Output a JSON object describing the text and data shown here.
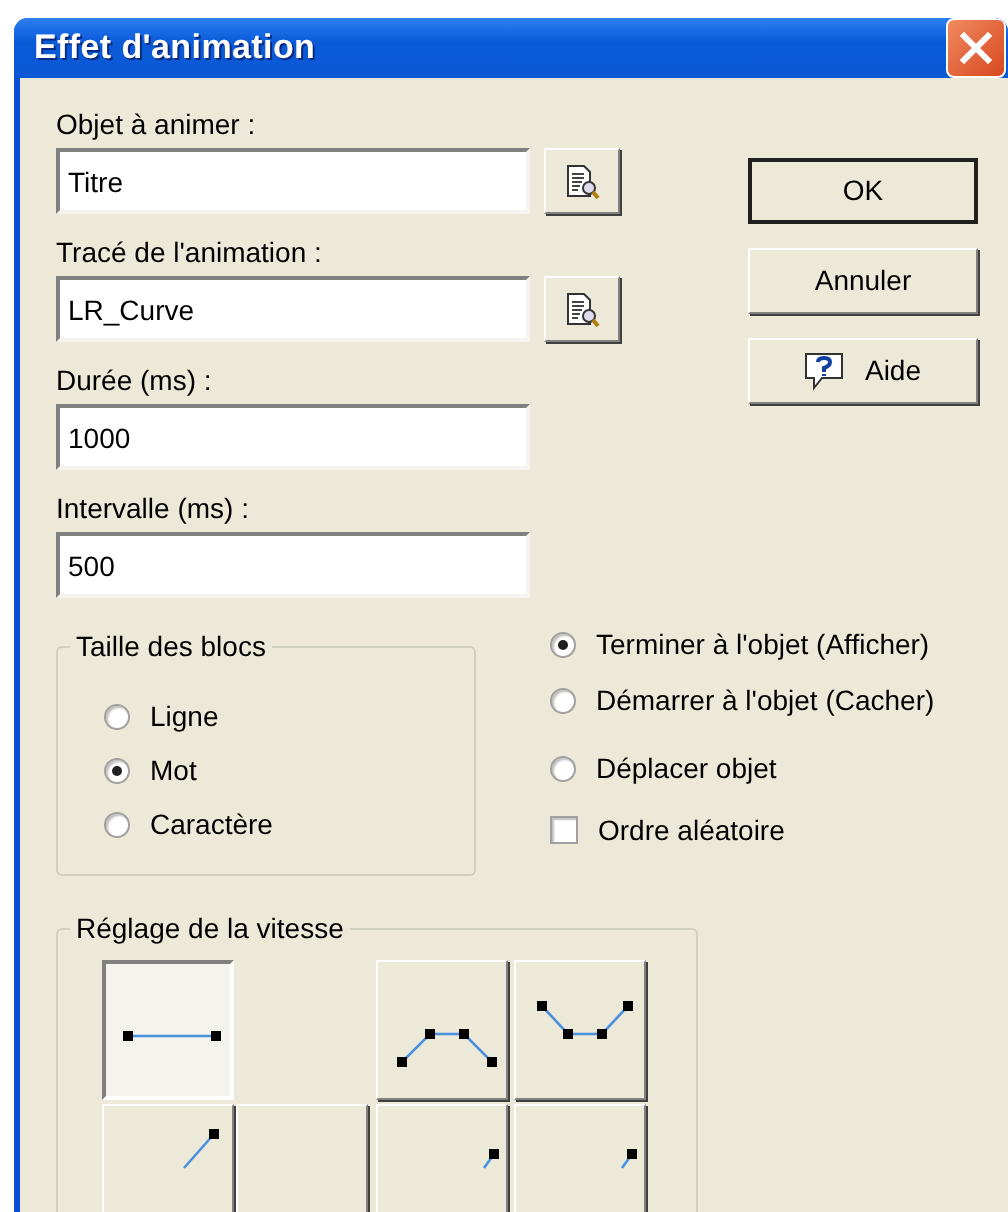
{
  "window": {
    "title": "Effet d'animation"
  },
  "fields": [
    {
      "label": "Objet à animer :",
      "value": "Titre",
      "browse": true
    },
    {
      "label": "Tracé de l'animation :",
      "value": "LR_Curve",
      "browse": true
    },
    {
      "label": "Durée (ms) :",
      "value": "1000",
      "browse": false
    },
    {
      "label": "Intervalle (ms) :",
      "value": "500",
      "browse": false
    }
  ],
  "buttons": [
    {
      "label": "OK",
      "kind": "plain",
      "default": true
    },
    {
      "label": "Annuler",
      "kind": "plain",
      "default": false
    },
    {
      "label": "Aide",
      "kind": "help",
      "default": false
    }
  ],
  "block_size": {
    "title": "Taille des blocs",
    "options": [
      {
        "label": "Ligne",
        "selected": false
      },
      {
        "label": "Mot",
        "selected": true
      },
      {
        "label": "Caractère",
        "selected": false
      }
    ]
  },
  "options": [
    {
      "kind": "radio",
      "label": "Terminer à l'objet (Afficher)",
      "selected": true
    },
    {
      "kind": "radio",
      "label": "Démarrer à l'objet (Cacher)",
      "selected": false
    },
    {
      "kind": "radio",
      "label": "Déplacer objet",
      "selected": false
    },
    {
      "kind": "checkbox",
      "label": "Ordre aléatoire",
      "checked": false
    }
  ],
  "speed": {
    "title": "Réglage de la vitesse",
    "rows": [
      [
        {
          "kind": "flat",
          "selected": true
        },
        {
          "kind": "gap"
        },
        {
          "kind": "hump",
          "selected": false
        },
        {
          "kind": "dip",
          "selected": false
        }
      ],
      [
        {
          "kind": "rise",
          "selected": false
        },
        {
          "kind": "blank",
          "selected": false
        },
        {
          "kind": "rise-late",
          "selected": false
        },
        {
          "kind": "rise-late",
          "selected": false
        }
      ]
    ]
  }
}
